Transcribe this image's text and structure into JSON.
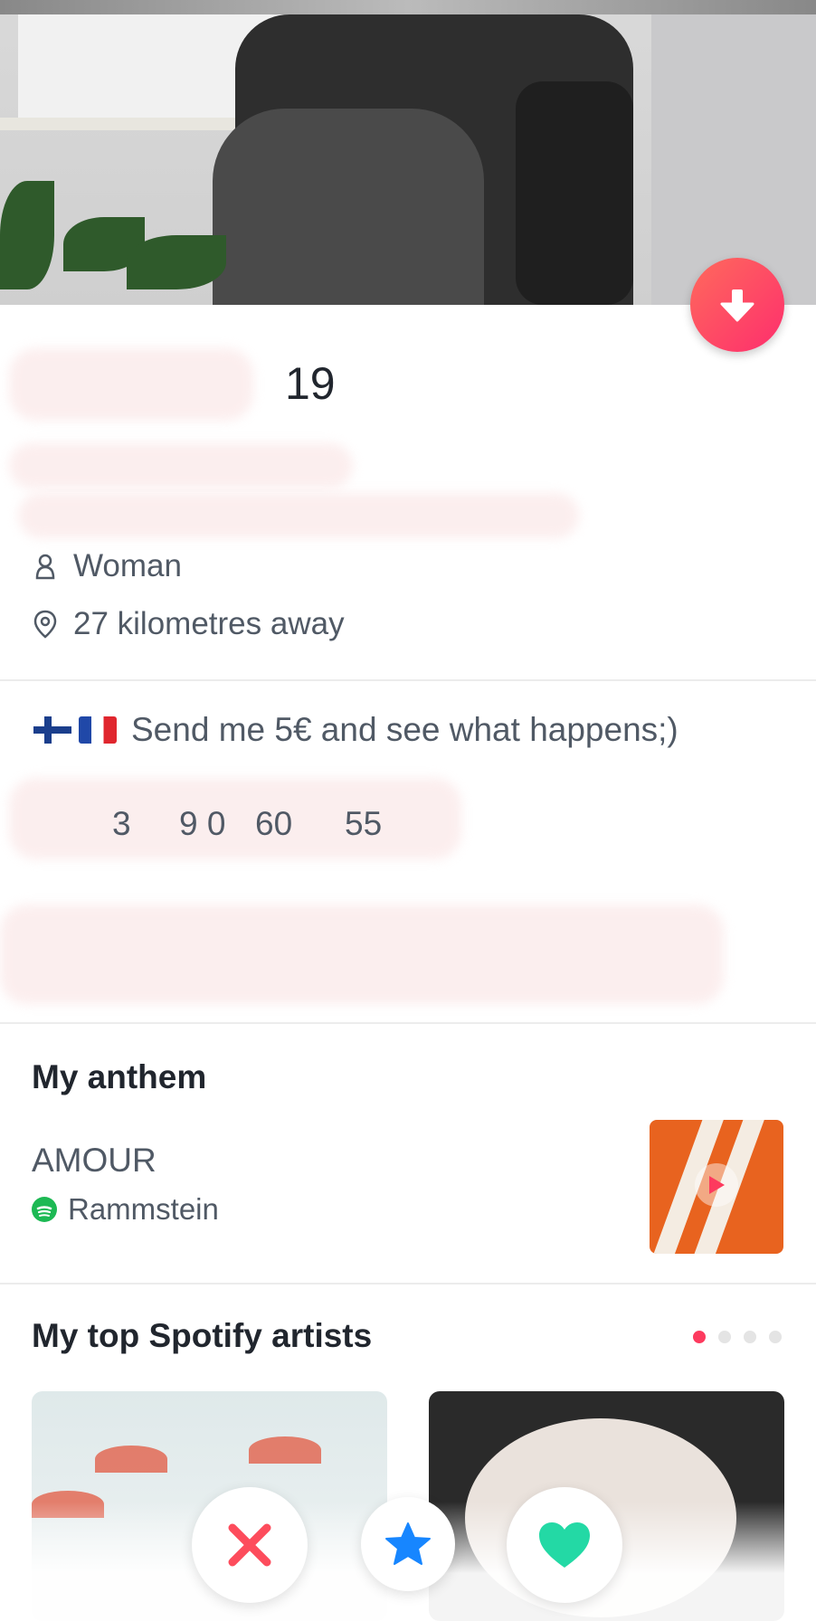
{
  "profile": {
    "age": "19",
    "gender": "Woman",
    "distance": "27 kilometres away",
    "bio": "Send me 5€ and see what happens;)",
    "bio_flags": [
      "finland-flag",
      "france-flag"
    ],
    "numbers_line": [
      "3",
      "9 0",
      "60",
      "55"
    ]
  },
  "anthem": {
    "title": "My anthem",
    "song": "AMOUR",
    "artist": "Rammstein"
  },
  "spotify_artists": {
    "title": "My top Spotify artists",
    "page_count": 4,
    "active_page": 1
  },
  "actions": {
    "nope_icon": "close-icon",
    "super_like_icon": "star-icon",
    "like_icon": "heart-icon"
  },
  "colors": {
    "accent": "#fd3a5e",
    "super_like": "#1786ff",
    "like": "#23d9a5",
    "nope": "#fd4c5c",
    "spotify": "#1db954"
  }
}
